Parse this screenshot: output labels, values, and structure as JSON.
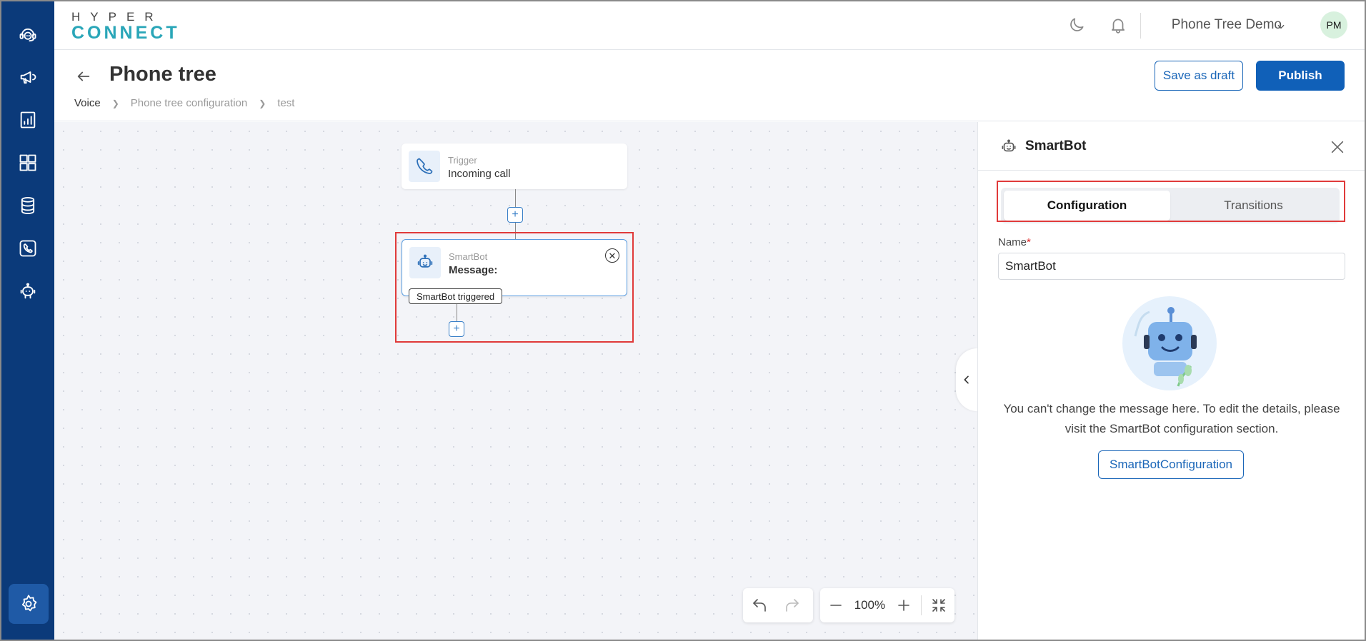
{
  "rail": {
    "items": [
      "support-agent-icon",
      "megaphone-icon",
      "analytics-icon",
      "dashboard-icon",
      "database-icon",
      "phone-icon",
      "bot-icon"
    ],
    "settings": "settings-icon"
  },
  "header": {
    "logo_top": "HYPER",
    "logo_bottom": "CONNECT",
    "workspace": "Phone Tree Demo",
    "avatar": "PM"
  },
  "page": {
    "title": "Phone tree",
    "breadcrumbs": [
      "Voice",
      "Phone tree configuration",
      "test"
    ],
    "save_draft": "Save as draft",
    "publish": "Publish"
  },
  "canvas": {
    "trigger_node": {
      "label": "Trigger",
      "value": "Incoming call"
    },
    "smartbot_node": {
      "label": "SmartBot",
      "value": "Message:",
      "tag": "SmartBot triggered"
    },
    "plus": "+",
    "zoom": "100%"
  },
  "panel": {
    "title": "SmartBot",
    "tabs": [
      {
        "label": "Configuration",
        "active": true
      },
      {
        "label": "Transitions",
        "active": false
      }
    ],
    "name_label": "Name",
    "required_mark": "*",
    "name_value": "SmartBot",
    "info": "You can't change the message here. To edit the details, please visit the SmartBot configuration section.",
    "config_button": "SmartBotConfiguration"
  },
  "colors": {
    "rail": "#0b3a7a",
    "primary": "#1060b8",
    "highlight": "#e03a3a",
    "canvas_bg": "#f3f4f8"
  }
}
